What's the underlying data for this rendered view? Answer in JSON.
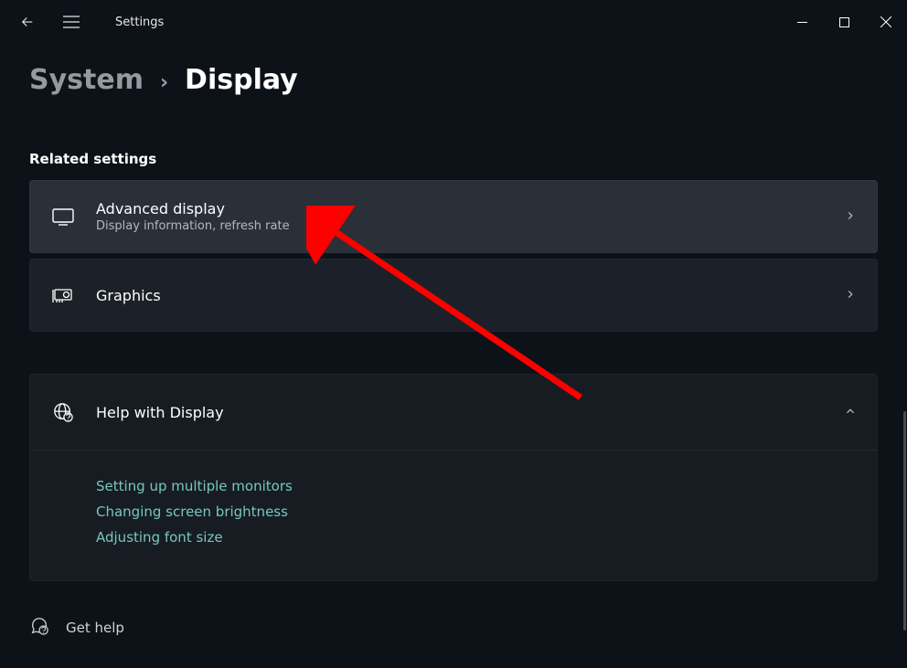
{
  "app": {
    "title": "Settings"
  },
  "breadcrumb": {
    "parent": "System",
    "separator": "›",
    "current": "Display"
  },
  "section": {
    "heading": "Related settings"
  },
  "cards": {
    "advanced": {
      "title": "Advanced display",
      "subtitle": "Display information, refresh rate"
    },
    "graphics": {
      "title": "Graphics"
    }
  },
  "help": {
    "title": "Help with Display",
    "links": {
      "monitors": "Setting up multiple monitors",
      "brightness": "Changing screen brightness",
      "font": "Adjusting font size"
    }
  },
  "footer": {
    "getHelp": "Get help"
  }
}
